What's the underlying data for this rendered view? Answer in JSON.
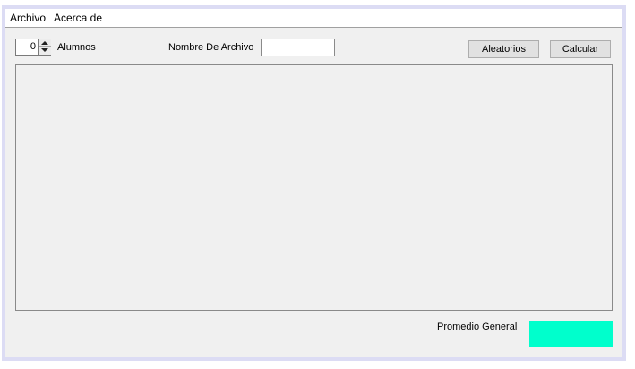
{
  "menu": {
    "items": [
      {
        "label": "Archivo"
      },
      {
        "label": "Acerca de"
      }
    ]
  },
  "toolbar": {
    "students_value": "0",
    "students_label": "Alumnos",
    "filename_label": "Nombre De Archivo",
    "filename_value": "",
    "random_label": "Aleatorios",
    "calculate_label": "Calcular"
  },
  "footer": {
    "average_label": "Promedio General",
    "average_value": "",
    "average_color": "#00ffcc"
  },
  "icons": {
    "spinner_up": "triangle-up",
    "spinner_down": "triangle-down"
  }
}
